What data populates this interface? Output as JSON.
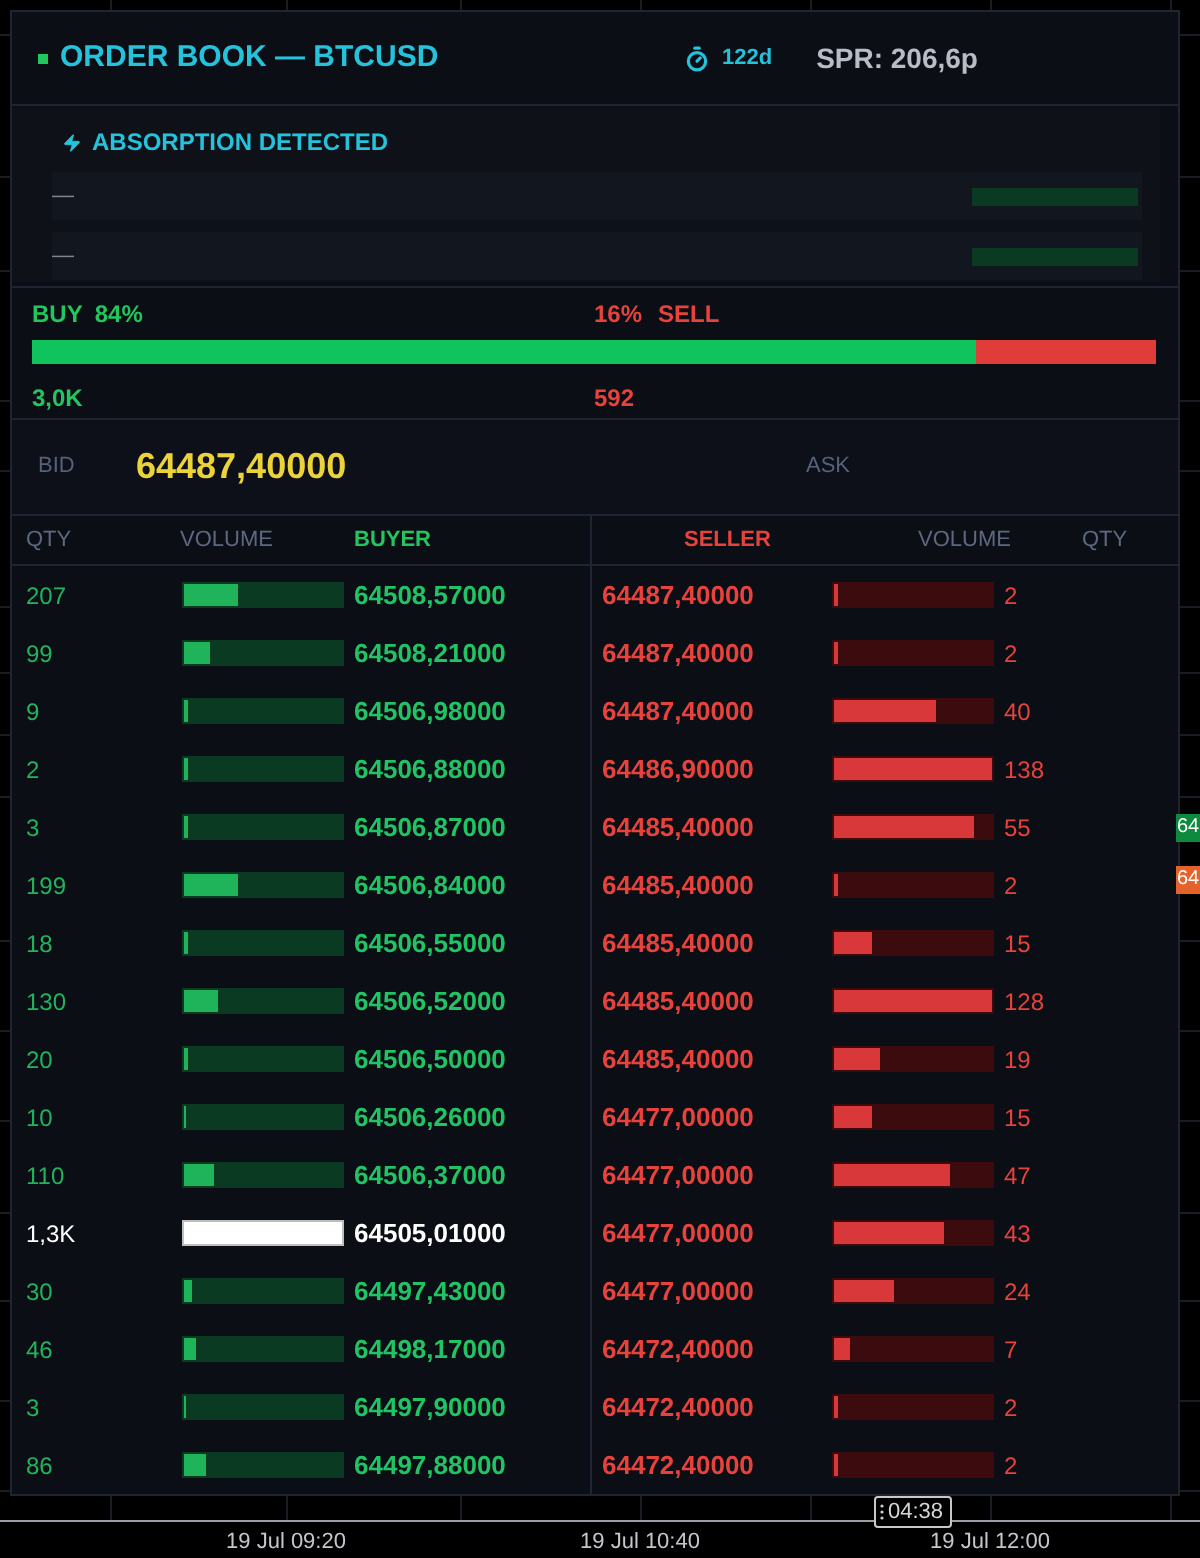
{
  "header": {
    "title": "ORDER BOOK — BTCUSD",
    "timer": "122d",
    "spread": "SPR: 206,6p"
  },
  "absorption": {
    "title": "ABSORPTION DETECTED",
    "rows": [
      {
        "label": "—"
      },
      {
        "label": "—"
      }
    ]
  },
  "pressure": {
    "buy_label": "BUY",
    "buy_percent": "84%",
    "sell_percent": "16%",
    "sell_label": "SELL",
    "level": 0.84,
    "buy_volume": "3,0K",
    "sell_volume": "592"
  },
  "quote": {
    "bid_label": "BID",
    "bid": "64487,40000",
    "ask_label": "ASK"
  },
  "columns": {
    "bid": [
      "QTY",
      "VOLUME",
      "BUYER"
    ],
    "ask": [
      "SELLER",
      "VOLUME",
      "QTY"
    ]
  },
  "rows": [
    {
      "bid": {
        "qty": "207",
        "level": 0.34,
        "price": "64508,57000",
        "highlighted": false
      },
      "ask": {
        "price": "64487,40000",
        "level": 0.03,
        "qty": "2"
      }
    },
    {
      "bid": {
        "qty": "99",
        "level": 0.17,
        "price": "64508,21000",
        "highlighted": false
      },
      "ask": {
        "price": "64487,40000",
        "level": 0.03,
        "qty": "2"
      }
    },
    {
      "bid": {
        "qty": "9",
        "level": 0.02,
        "price": "64506,98000",
        "highlighted": false
      },
      "ask": {
        "price": "64487,40000",
        "level": 0.64,
        "qty": "40"
      }
    },
    {
      "bid": {
        "qty": "2",
        "level": 0.02,
        "price": "64506,88000",
        "highlighted": false
      },
      "ask": {
        "price": "64486,90000",
        "level": 1,
        "qty": "138"
      }
    },
    {
      "bid": {
        "qty": "3",
        "level": 0.02,
        "price": "64506,87000",
        "highlighted": false
      },
      "ask": {
        "price": "64485,40000",
        "level": 0.88,
        "qty": "55"
      }
    },
    {
      "bid": {
        "qty": "199",
        "level": 0.34,
        "price": "64506,84000",
        "highlighted": false
      },
      "ask": {
        "price": "64485,40000",
        "level": 0.03,
        "qty": "2"
      }
    },
    {
      "bid": {
        "qty": "18",
        "level": 0.03,
        "price": "64506,55000",
        "highlighted": false
      },
      "ask": {
        "price": "64485,40000",
        "level": 0.24,
        "qty": "15"
      }
    },
    {
      "bid": {
        "qty": "130",
        "level": 0.22,
        "price": "64506,52000",
        "highlighted": false
      },
      "ask": {
        "price": "64485,40000",
        "level": 1,
        "qty": "128"
      }
    },
    {
      "bid": {
        "qty": "20",
        "level": 0.02,
        "price": "64506,50000",
        "highlighted": false
      },
      "ask": {
        "price": "64485,40000",
        "level": 0.29,
        "qty": "19"
      }
    },
    {
      "bid": {
        "qty": "10",
        "level": 0.015,
        "price": "64506,26000",
        "highlighted": false
      },
      "ask": {
        "price": "64477,00000",
        "level": 0.24,
        "qty": "15"
      }
    },
    {
      "bid": {
        "qty": "110",
        "level": 0.19,
        "price": "64506,37000",
        "highlighted": false
      },
      "ask": {
        "price": "64477,00000",
        "level": 0.74,
        "qty": "47"
      }
    },
    {
      "bid": {
        "qty": "1,3K",
        "level": 1,
        "price": "64505,01000",
        "highlighted": true
      },
      "ask": {
        "price": "64477,00000",
        "level": 0.69,
        "qty": "43"
      }
    },
    {
      "bid": {
        "qty": "30",
        "level": 0.05,
        "price": "64497,43000",
        "highlighted": false
      },
      "ask": {
        "price": "64477,00000",
        "level": 0.38,
        "qty": "24"
      }
    },
    {
      "bid": {
        "qty": "46",
        "level": 0.08,
        "price": "64498,17000",
        "highlighted": false
      },
      "ask": {
        "price": "64472,40000",
        "level": 0.1,
        "qty": "7"
      }
    },
    {
      "bid": {
        "qty": "3",
        "level": 0.015,
        "price": "64497,90000",
        "highlighted": false
      },
      "ask": {
        "price": "64472,40000",
        "level": 0.03,
        "qty": "2"
      }
    },
    {
      "bid": {
        "qty": "86",
        "level": 0.14,
        "price": "64497,88000",
        "highlighted": false
      },
      "ask": {
        "price": "64472,40000",
        "level": 0.03,
        "qty": "2"
      }
    }
  ],
  "time_axis": {
    "labels": [
      "19 Jul 09:20",
      "19 Jul 10:40",
      "19 Jul 12:00"
    ],
    "cursor": "04:38"
  },
  "price_tags": [
    {
      "text": "64",
      "color": "#0e8a3e"
    },
    {
      "text": "64",
      "color": "#e5622b"
    }
  ]
}
